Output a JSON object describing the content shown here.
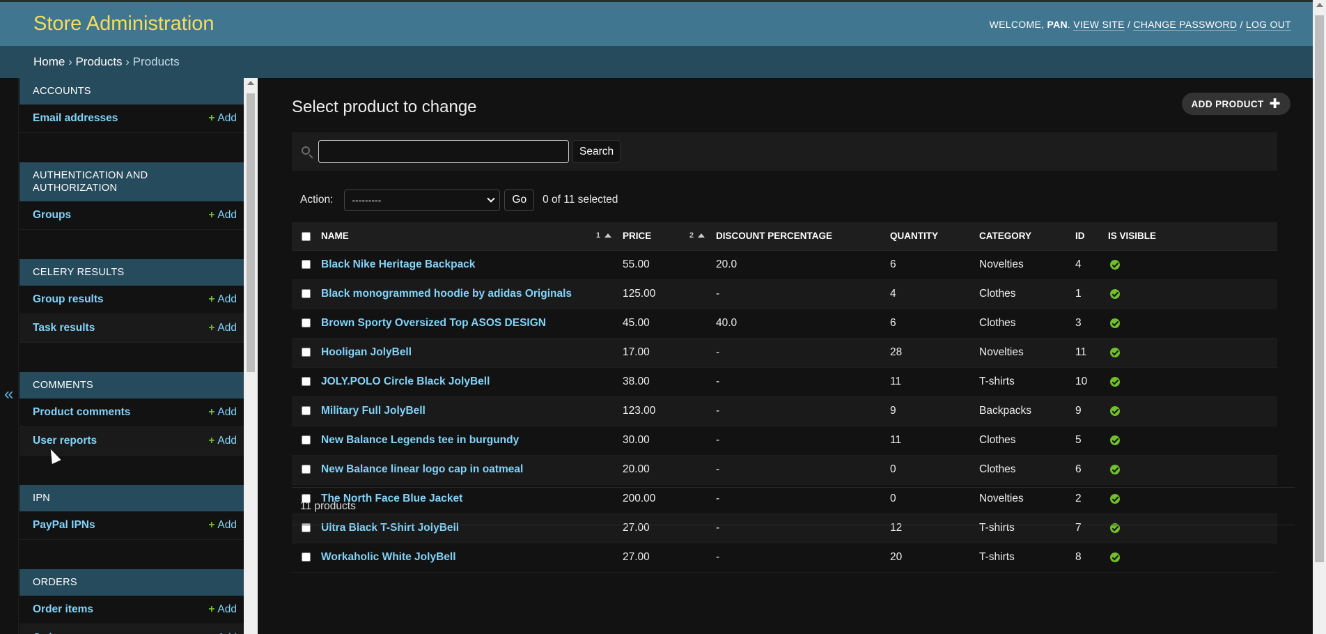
{
  "header": {
    "branding": "Store Administration",
    "welcome": "WELCOME,",
    "username": "PAN",
    "view_site": "VIEW SITE",
    "change_password": "CHANGE PASSWORD",
    "log_out": "LOG OUT"
  },
  "breadcrumbs": {
    "home": "Home",
    "app": "Products",
    "current": "Products"
  },
  "nav": {
    "collapse": "«",
    "add_label": "Add",
    "modules": [
      {
        "caption": "ACCOUNTS",
        "models": [
          "Email addresses"
        ]
      },
      {
        "caption": "AUTHENTICATION AND AUTHORIZATION",
        "models": [
          "Groups"
        ]
      },
      {
        "caption": "CELERY RESULTS",
        "models": [
          "Group results",
          "Task results"
        ]
      },
      {
        "caption": "COMMENTS",
        "models": [
          "Product comments",
          "User reports"
        ]
      },
      {
        "caption": "IPN",
        "models": [
          "PayPal IPNs"
        ]
      },
      {
        "caption": "ORDERS",
        "models": [
          "Order items",
          "Orders"
        ]
      }
    ]
  },
  "content": {
    "title": "Select product to change",
    "add_button": "ADD PRODUCT",
    "search_button": "Search",
    "search_value": "",
    "action_label": "Action:",
    "action_selected": "---------",
    "go_button": "Go",
    "action_counter": "0 of 11 selected",
    "paginator": "11 products"
  },
  "table": {
    "columns": [
      "NAME",
      "PRICE",
      "DISCOUNT PERCENTAGE",
      "QUANTITY",
      "CATEGORY",
      "ID",
      "IS VISIBLE"
    ],
    "sort_priorities": {
      "name": "1",
      "price": "2"
    },
    "rows": [
      [
        "Black Nike Heritage Backpack",
        "55.00",
        "20.0",
        "6",
        "Novelties",
        "4"
      ],
      [
        "Black monogrammed hoodie by adidas Originals",
        "125.00",
        "-",
        "4",
        "Clothes",
        "1"
      ],
      [
        "Brown Sporty Oversized Top ASOS DESIGN",
        "45.00",
        "40.0",
        "6",
        "Clothes",
        "3"
      ],
      [
        "Hooligan JolyBell",
        "17.00",
        "-",
        "28",
        "Novelties",
        "11"
      ],
      [
        "JOLY.POLO Circle Black JolyBell",
        "38.00",
        "-",
        "11",
        "T-shirts",
        "10"
      ],
      [
        "Military Full JolyBell",
        "123.00",
        "-",
        "9",
        "Backpacks",
        "9"
      ],
      [
        "New Balance Legends tee in burgundy",
        "30.00",
        "-",
        "11",
        "Clothes",
        "5"
      ],
      [
        "New Balance linear logo cap in oatmeal",
        "20.00",
        "-",
        "0",
        "Clothes",
        "6"
      ],
      [
        "The North Face Blue Jacket",
        "200.00",
        "-",
        "0",
        "Novelties",
        "2"
      ],
      [
        "Ultra Black T-Shirt JolyBell",
        "27.00",
        "-",
        "12",
        "T-shirts",
        "7"
      ],
      [
        "Workaholic White JolyBell",
        "27.00",
        "-",
        "20",
        "T-shirts",
        "8"
      ]
    ],
    "visible": [
      true,
      true,
      true,
      true,
      true,
      true,
      true,
      true,
      true,
      true,
      true
    ]
  },
  "colors": {
    "header": "#417690",
    "breadcrumbs": "#264b5d",
    "branding": "#f5dd5d",
    "link": "#81d4fa",
    "add_plus": "#70bf2b"
  }
}
